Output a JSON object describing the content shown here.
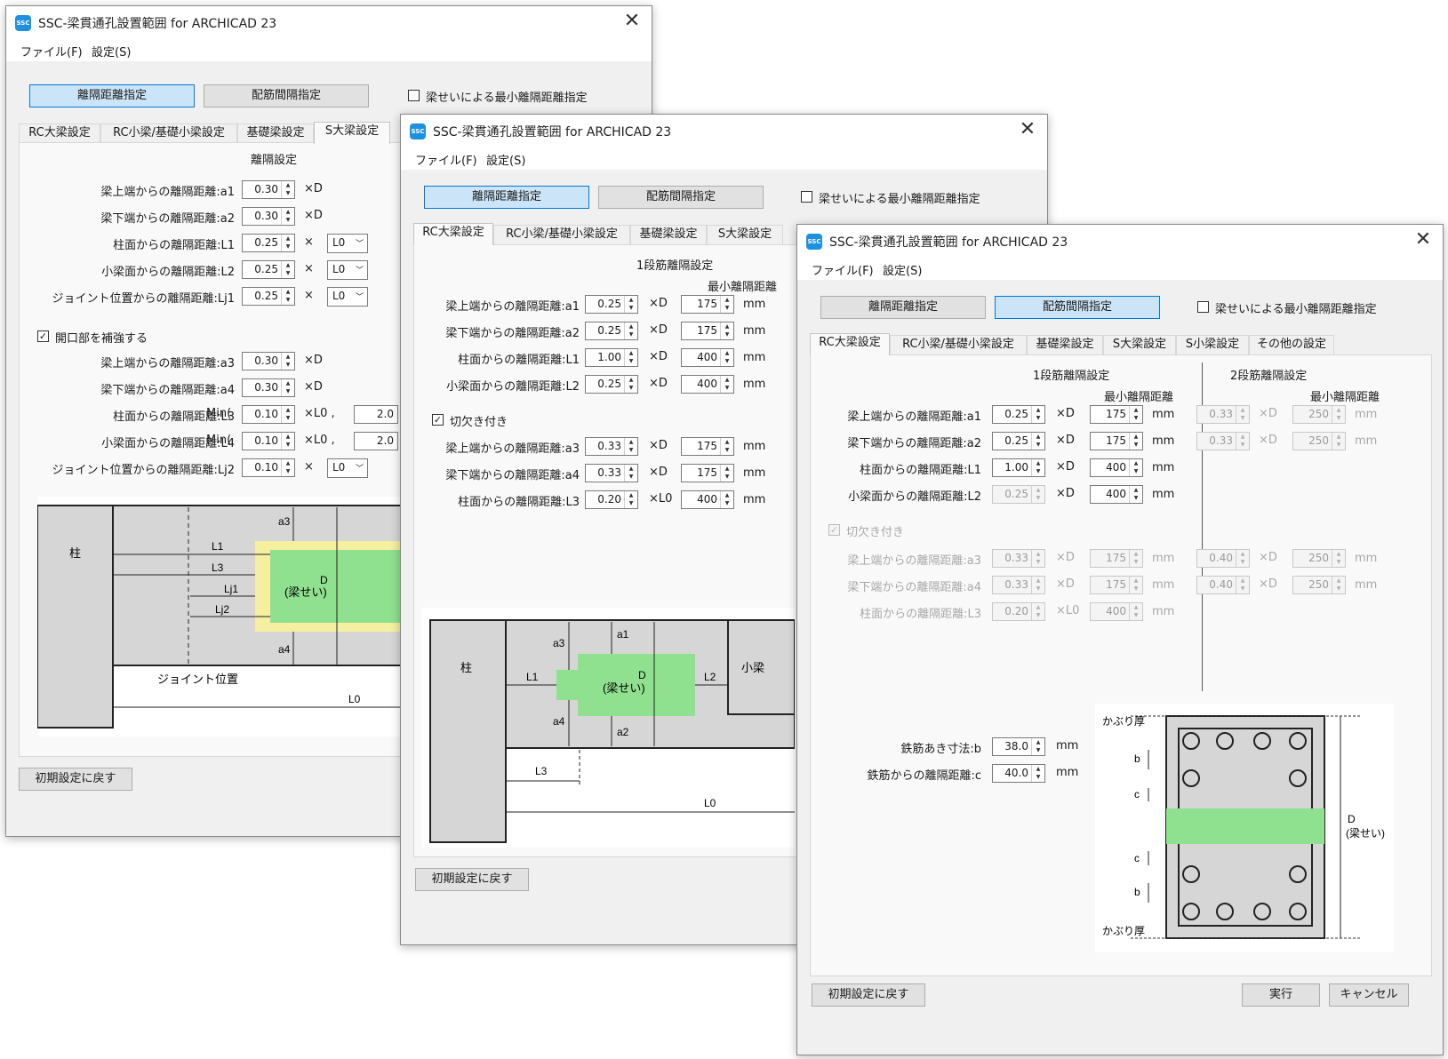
{
  "app_title": "SSC-梁貫通孔設置範囲 for ARCHICAD 23",
  "app_icon_text": "SSC",
  "menus": [
    "ファイル(F)",
    "設定(S)"
  ],
  "mode_buttons": {
    "distance": "離隔距離指定",
    "rebar": "配筋間隔指定"
  },
  "min_dist_checkbox": "梁せいによる最小離隔距離指定",
  "reset_button": "初期設定に戻す",
  "close_glyph": "✕",
  "window1": {
    "tabs": [
      "RC大梁設定",
      "RC小梁/基礎小梁設定",
      "基礎梁設定",
      "S大梁設定"
    ],
    "active_tab": 3,
    "section_title": "離隔設定",
    "rows": [
      {
        "label": "梁上端からの離隔距離:a1",
        "value": "0.30",
        "unit": "×D"
      },
      {
        "label": "梁下端からの離隔距離:a2",
        "value": "0.30",
        "unit": "×D"
      },
      {
        "label": "柱面からの離隔距離:L1",
        "value": "0.25",
        "unit": "×",
        "combo": "L0"
      },
      {
        "label": "小梁面からの離隔距離:L2",
        "value": "0.25",
        "unit": "×",
        "combo": "L0"
      },
      {
        "label": "ジョイント位置からの離隔距離:Lj1",
        "value": "0.25",
        "unit": "×",
        "combo": "L0"
      }
    ],
    "reinforce_checkbox": "開口部を補強する",
    "rows2": [
      {
        "label": "梁上端からの離隔距離:a3",
        "value": "0.30",
        "unit": "×D"
      },
      {
        "label": "梁下端からの離隔距離:a4",
        "value": "0.30",
        "unit": "×D"
      },
      {
        "label": "柱面からの離隔距離:L3",
        "min": "Min(",
        "value": "0.10",
        "unit": "×L0 ,",
        "extra": "2.0"
      },
      {
        "label": "小梁面からの離隔距離:L4",
        "min": "Min(",
        "value": "0.10",
        "unit": "×L0 ,",
        "extra": "2.0"
      },
      {
        "label": "ジョイント位置からの離隔距離:Lj2",
        "value": "0.10",
        "unit": "×",
        "combo": "L0"
      }
    ],
    "diagram": {
      "column": "柱",
      "L1": "L1",
      "L3": "L3",
      "Lj1": "Lj1",
      "Lj2": "Lj2",
      "a3": "a3",
      "a4": "a4",
      "D": "D",
      "beam": "(梁せい)",
      "joint": "ジョイント位置",
      "L0": "L0"
    }
  },
  "window2": {
    "tabs": [
      "RC大梁設定",
      "RC小梁/基礎小梁設定",
      "基礎梁設定",
      "S大梁設定"
    ],
    "active_tab": 0,
    "section_title": "1段筋離隔設定",
    "min_header": "最小離隔距離",
    "rows": [
      {
        "label": "梁上端からの離隔距離:a1",
        "value": "0.25",
        "unit": "×D",
        "min": "175",
        "mm": "mm"
      },
      {
        "label": "梁下端からの離隔距離:a2",
        "value": "0.25",
        "unit": "×D",
        "min": "175",
        "mm": "mm"
      },
      {
        "label": "柱面からの離隔距離:L1",
        "value": "1.00",
        "unit": "×D",
        "min": "400",
        "mm": "mm"
      },
      {
        "label": "小梁面からの離隔距離:L2",
        "value": "0.25",
        "unit": "×D",
        "min": "400",
        "mm": "mm"
      }
    ],
    "notch_checkbox": "切欠き付き",
    "rows2": [
      {
        "label": "梁上端からの離隔距離:a3",
        "value": "0.33",
        "unit": "×D",
        "min": "175",
        "mm": "mm"
      },
      {
        "label": "梁下端からの離隔距離:a4",
        "value": "0.33",
        "unit": "×D",
        "min": "175",
        "mm": "mm"
      },
      {
        "label": "柱面からの離隔距離:L3",
        "value": "0.20",
        "unit": "×L0",
        "min": "400",
        "mm": "mm"
      }
    ],
    "diagram": {
      "column": "柱",
      "small_beam": "小梁",
      "a1": "a1",
      "a2": "a2",
      "a3": "a3",
      "a4": "a4",
      "L1": "L1",
      "L2": "L2",
      "L3": "L3",
      "L0": "L0",
      "D": "D",
      "beam": "(梁せい)"
    }
  },
  "window3": {
    "tabs": [
      "RC大梁設定",
      "RC小梁/基礎小梁設定",
      "基礎梁設定",
      "S大梁設定",
      "S小梁設定",
      "その他の設定"
    ],
    "active_tab": 0,
    "section1_title": "1段筋離隔設定",
    "section2_title": "2段筋離隔設定",
    "min_header": "最小離隔距離",
    "rows": [
      {
        "label": "梁上端からの離隔距離:a1",
        "value": "0.25",
        "unit": "×D",
        "min": "175",
        "mm": "mm",
        "v2": "0.33",
        "unit2": "×D",
        "min2": "250",
        "mm2": "mm"
      },
      {
        "label": "梁下端からの離隔距離:a2",
        "value": "0.25",
        "unit": "×D",
        "min": "175",
        "mm": "mm",
        "v2": "0.33",
        "unit2": "×D",
        "min2": "250",
        "mm2": "mm"
      },
      {
        "label": "柱面からの離隔距離:L1",
        "value": "1.00",
        "unit": "×D",
        "min": "400",
        "mm": "mm"
      },
      {
        "label": "小梁面からの離隔距離:L2",
        "value": "0.25",
        "unit": "×D",
        "min": "400",
        "mm": "mm"
      }
    ],
    "notch_checkbox": "切欠き付き",
    "rows2": [
      {
        "label": "梁上端からの離隔距離:a3",
        "value": "0.33",
        "unit": "×D",
        "min": "175",
        "mm": "mm",
        "v2": "0.40",
        "unit2": "×D",
        "min2": "250",
        "mm2": "mm"
      },
      {
        "label": "梁下端からの離隔距離:a4",
        "value": "0.33",
        "unit": "×D",
        "min": "175",
        "mm": "mm",
        "v2": "0.40",
        "unit2": "×D",
        "min2": "250",
        "mm2": "mm"
      },
      {
        "label": "柱面からの離隔距離:L3",
        "value": "0.20",
        "unit": "×L0",
        "min": "400",
        "mm": "mm"
      }
    ],
    "rebar_gap": {
      "label": "鉄筋あき寸法:b",
      "value": "38.0",
      "mm": "mm"
    },
    "rebar_dist": {
      "label": "鉄筋からの離隔距離:c",
      "value": "40.0",
      "mm": "mm"
    },
    "diagram": {
      "cover_top": "かぶり厚",
      "cover_bottom": "かぶり厚",
      "b": "b",
      "c": "c",
      "D": "D",
      "beam": "(梁せい)"
    },
    "run_button": "実行",
    "cancel_button": "キャンセル"
  },
  "colors": {
    "green": "#8fe08f",
    "yellow": "#f5f0a0",
    "accent": "#0078d7"
  }
}
